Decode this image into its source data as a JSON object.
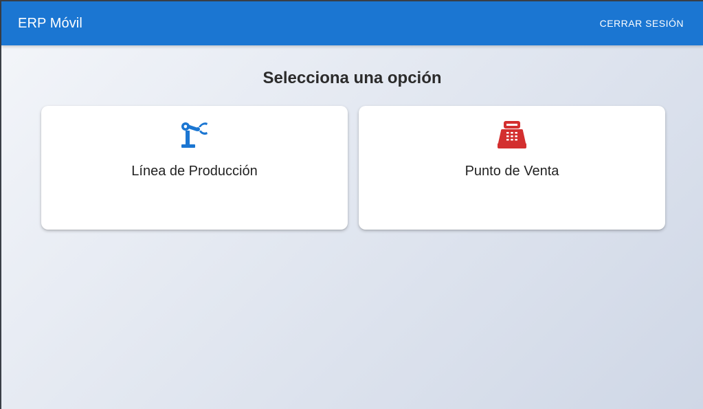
{
  "header": {
    "title": "ERP Móvil",
    "logout_label": "CERRAR SESIÓN"
  },
  "main": {
    "heading": "Selecciona una opción",
    "options": [
      {
        "label": "Línea de Producción",
        "icon": "robot-arm-icon",
        "color": "#1b76d2"
      },
      {
        "label": "Punto de Venta",
        "icon": "cash-register-icon",
        "color": "#d32f2f"
      }
    ]
  },
  "colors": {
    "appbar": "#1b76d2",
    "production_icon": "#1b76d2",
    "pos_icon": "#d32f2f"
  }
}
